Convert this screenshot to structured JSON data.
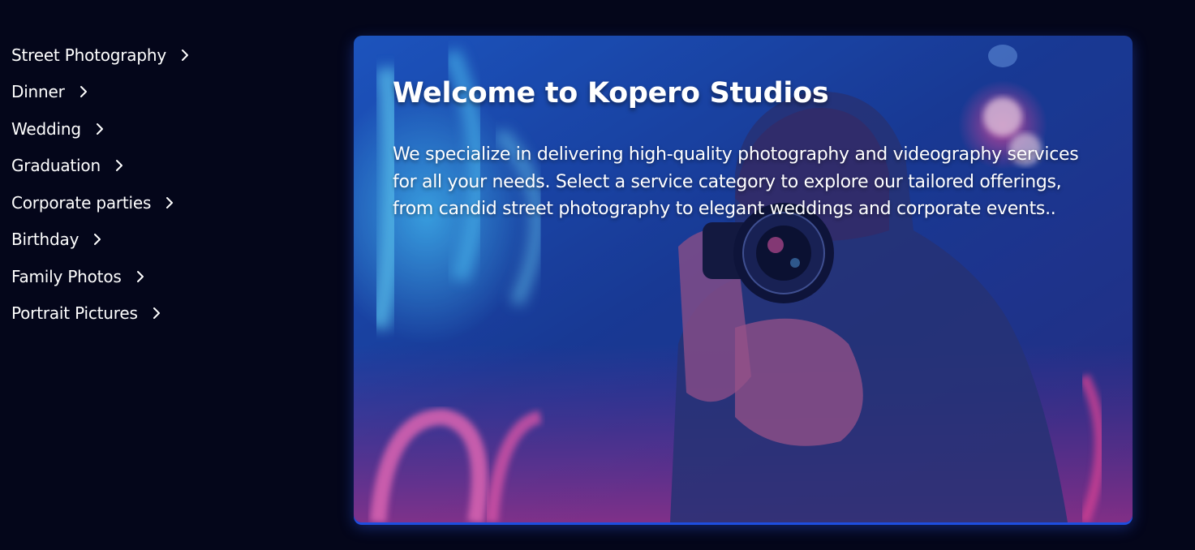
{
  "sidebar": {
    "items": [
      {
        "label": "Street Photography",
        "icon": "chevron-right-icon"
      },
      {
        "label": "Dinner",
        "icon": "chevron-right-icon"
      },
      {
        "label": "Wedding",
        "icon": "chevron-right-icon"
      },
      {
        "label": "Graduation",
        "icon": "chevron-right-icon"
      },
      {
        "label": "Corporate parties",
        "icon": "chevron-right-icon"
      },
      {
        "label": "Birthday",
        "icon": "chevron-right-icon"
      },
      {
        "label": "Family Photos",
        "icon": "chevron-right-icon"
      },
      {
        "label": "Portrait Pictures",
        "icon": "chevron-right-icon"
      }
    ]
  },
  "hero": {
    "title": "Welcome to Kopero Studios",
    "description": "We specialize in delivering high-quality photography and videography services for all your needs. Select a service category to explore our tailored offerings, from candid street photography to elegant weddings and corporate events..",
    "image_subject": "photographer with camera in neon-lit scene"
  },
  "colors": {
    "background": "#04061a",
    "text": "#ffffff",
    "card_glow": "#1e4ee0",
    "neon_blue": "#2fa8ff",
    "neon_pink": "#e0409a"
  }
}
